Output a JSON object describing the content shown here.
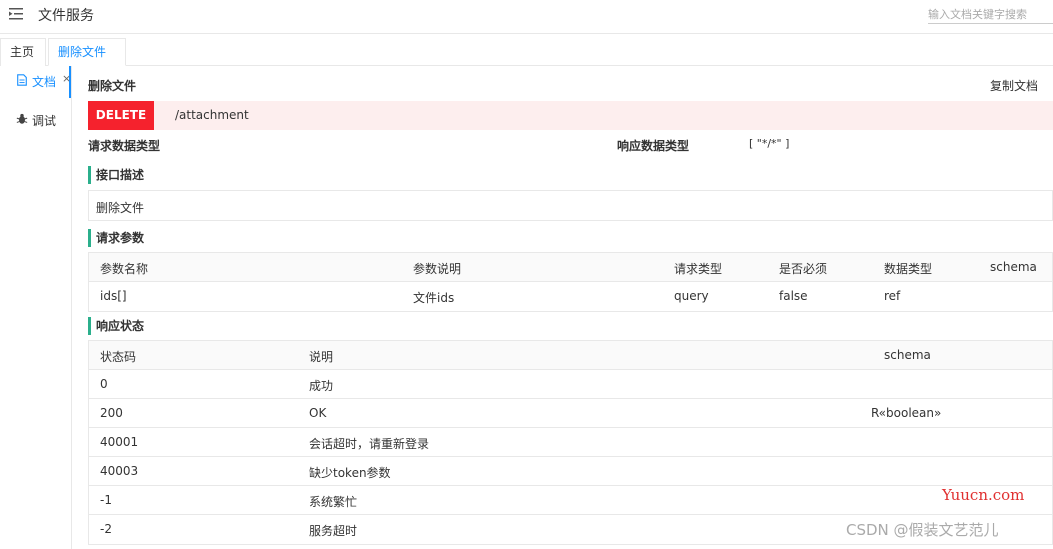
{
  "header": {
    "menu_icon": "menu-fold-icon",
    "title": "文件服务",
    "search_placeholder": "输入文档关键字搜索"
  },
  "tabs": [
    {
      "label": "主页"
    },
    {
      "label": "删除文件",
      "close": "×"
    }
  ],
  "sidenav": {
    "items": [
      {
        "label": "文档",
        "icon": "document-icon",
        "active": true
      },
      {
        "label": "调试",
        "icon": "bug-icon",
        "active": false
      }
    ]
  },
  "doc": {
    "title": "删除文件",
    "copy_label": "复制文档",
    "method": "DELETE",
    "path": "/attachment",
    "request_type_label": "请求数据类型",
    "request_type_value": "",
    "response_type_label": "响应数据类型",
    "response_type_value": "[ \"*/*\" ]",
    "method_color": "#f5222d",
    "accent_color": "#1890ff",
    "section_color": "#2baf8c"
  },
  "description": {
    "title": "接口描述",
    "text": "删除文件"
  },
  "params": {
    "title": "请求参数",
    "headers": [
      "参数名称",
      "参数说明",
      "请求类型",
      "是否必须",
      "数据类型",
      "schema"
    ],
    "rows": [
      [
        "ids[]",
        "文件ids",
        "query",
        "false",
        "ref",
        ""
      ]
    ]
  },
  "responses": {
    "title": "响应状态",
    "headers": [
      "状态码",
      "说明",
      "schema"
    ],
    "rows": [
      [
        "0",
        "成功",
        ""
      ],
      [
        "200",
        "OK",
        "R«boolean»"
      ],
      [
        "40001",
        "会话超时，请重新登录",
        ""
      ],
      [
        "40003",
        "缺少token参数",
        ""
      ],
      [
        "-1",
        "系统繁忙",
        ""
      ],
      [
        "-2",
        "服务超时",
        ""
      ]
    ]
  },
  "watermarks": {
    "site": "Yuucn.com",
    "credit": "CSDN @假装文艺范儿"
  }
}
